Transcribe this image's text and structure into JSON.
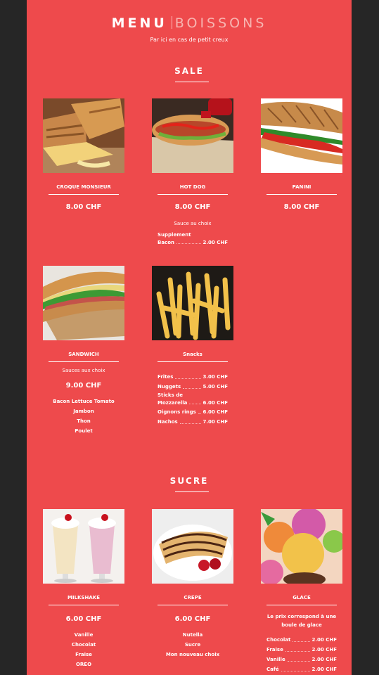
{
  "nav": {
    "menu_label": "MENU",
    "drinks_label": "BOISSONS",
    "tagline": "Par ici en cas de petit creux"
  },
  "sections": {
    "sale": "SALE",
    "sucre": "SUCRE"
  },
  "items": {
    "croque": {
      "name": "CROQUE MONSIEUR",
      "price": "8.00 CHF"
    },
    "hotdog": {
      "name": "HOT DOG",
      "price": "8.00 CHF",
      "note": "Sauce au choix",
      "supplement_label": "Supplement",
      "supplement_item": "Bacon",
      "supplement_price": "2.00 CHF"
    },
    "panini": {
      "name": "PANINI",
      "price": "8.00 CHF"
    },
    "sandwich": {
      "name": "SANDWICH",
      "note": "Sauces aux choix",
      "price": "9.00 CHF",
      "options": [
        "Bacon Lettuce Tomato",
        "Jambon",
        "Thon",
        "Poulet"
      ]
    },
    "snacks": {
      "name": "Snacks",
      "rows": [
        {
          "label": "Frites",
          "price": "3.00 CHF"
        },
        {
          "label": "Nuggets",
          "price": "5.00 CHF"
        },
        {
          "label": "Sticks de",
          "price": ""
        },
        {
          "label": "Mozzarella",
          "price": "6.00 CHF"
        },
        {
          "label": "Oignons rings",
          "price": "6.00 CHF"
        },
        {
          "label": "Nachos",
          "price": "7.00 CHF"
        }
      ]
    },
    "milkshake": {
      "name": "MILKSHAKE",
      "price": "6.00 CHF",
      "options": [
        "Vanille",
        "Chocolat",
        "Fraise",
        "OREO"
      ]
    },
    "crepe": {
      "name": "CREPE",
      "price": "6.00 CHF",
      "options": [
        "Nutella",
        "Sucre",
        "Mon nouveau choix"
      ]
    },
    "glace": {
      "name": "GLACE",
      "note": "Le prix correspond à une boule de glace",
      "rows": [
        {
          "label": "Chocolat",
          "price": "2.00 CHF"
        },
        {
          "label": "Fraise",
          "price": "2.00 CHF"
        },
        {
          "label": "Vanille",
          "price": "2.00 CHF"
        },
        {
          "label": "Café",
          "price": "2.00 CHF"
        }
      ]
    }
  },
  "colors": {
    "background": "#ee4a4c",
    "frame": "#262626",
    "text": "#ffffff"
  }
}
